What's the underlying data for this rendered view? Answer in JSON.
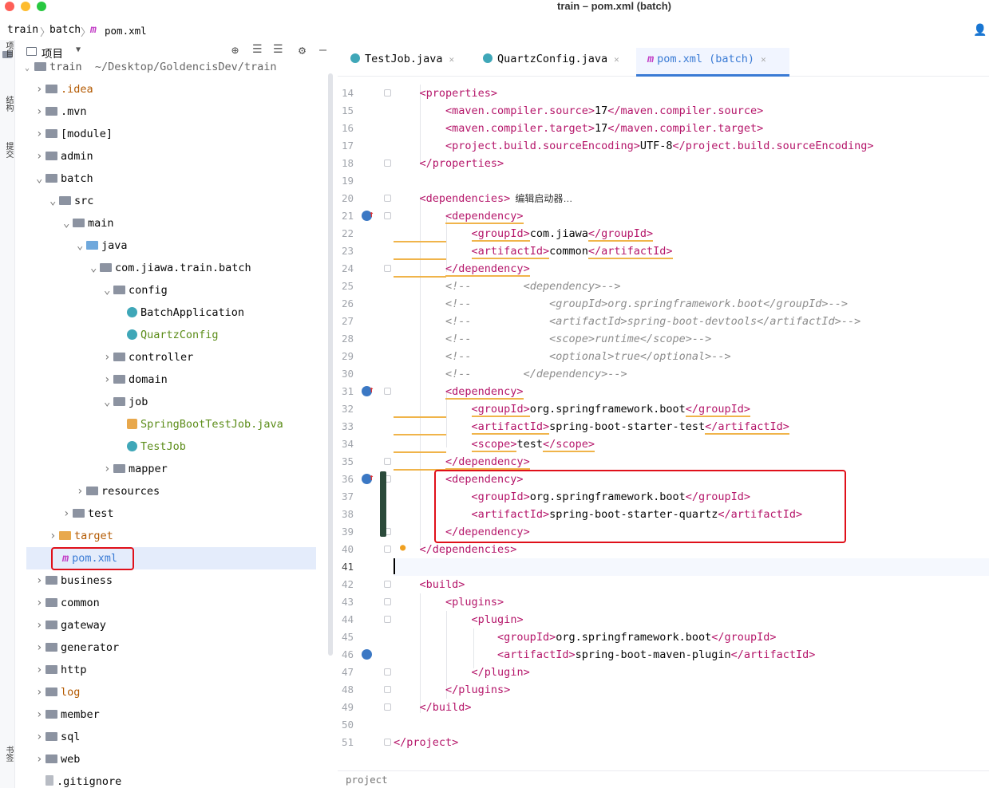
{
  "window": {
    "title": "train – pom.xml (batch)"
  },
  "breadcrumb": {
    "items": [
      "train",
      "batch",
      "pom.xml"
    ]
  },
  "left_strip": {
    "items": [
      "项目",
      "结构",
      "提交",
      "书签"
    ]
  },
  "project_panel": {
    "title": "项目",
    "root_label": "train",
    "root_path": "~/Desktop/GoldencisDev/train"
  },
  "tree": [
    {
      "label": ".idea",
      "depth": 1,
      "type": "folder",
      "color": "#b35900"
    },
    {
      "label": ".mvn",
      "depth": 1,
      "type": "folder"
    },
    {
      "label": "[module]",
      "depth": 1,
      "type": "folder"
    },
    {
      "label": "admin",
      "depth": 1,
      "type": "module"
    },
    {
      "label": "batch",
      "depth": 1,
      "type": "module",
      "open": true
    },
    {
      "label": "src",
      "depth": 2,
      "type": "folder",
      "open": true
    },
    {
      "label": "main",
      "depth": 3,
      "type": "folder",
      "open": true
    },
    {
      "label": "java",
      "depth": 4,
      "type": "folder-blue",
      "open": true
    },
    {
      "label": "com.jiawa.train.batch",
      "depth": 5,
      "type": "package",
      "open": true
    },
    {
      "label": "config",
      "depth": 6,
      "type": "package",
      "open": true
    },
    {
      "label": "BatchApplication",
      "depth": 7,
      "type": "class"
    },
    {
      "label": "QuartzConfig",
      "depth": 7,
      "type": "class",
      "color": "#5b8c18"
    },
    {
      "label": "controller",
      "depth": 6,
      "type": "package"
    },
    {
      "label": "domain",
      "depth": 6,
      "type": "package"
    },
    {
      "label": "job",
      "depth": 6,
      "type": "package",
      "open": true
    },
    {
      "label": "SpringBootTestJob.java",
      "depth": 7,
      "type": "java",
      "color": "#5b8c18"
    },
    {
      "label": "TestJob",
      "depth": 7,
      "type": "class",
      "color": "#5b8c18"
    },
    {
      "label": "mapper",
      "depth": 6,
      "type": "package"
    },
    {
      "label": "resources",
      "depth": 4,
      "type": "folder"
    },
    {
      "label": "test",
      "depth": 3,
      "type": "folder"
    },
    {
      "label": "target",
      "depth": 2,
      "type": "folder-orange",
      "color": "#b35900"
    },
    {
      "label": "pom.xml",
      "depth": 2,
      "type": "maven",
      "color": "#3a7bd5",
      "selected": true
    },
    {
      "label": "business",
      "depth": 1,
      "type": "module"
    },
    {
      "label": "common",
      "depth": 1,
      "type": "module"
    },
    {
      "label": "gateway",
      "depth": 1,
      "type": "module"
    },
    {
      "label": "generator",
      "depth": 1,
      "type": "module"
    },
    {
      "label": "http",
      "depth": 1,
      "type": "folder"
    },
    {
      "label": "log",
      "depth": 1,
      "type": "folder",
      "color": "#b35900"
    },
    {
      "label": "member",
      "depth": 1,
      "type": "module"
    },
    {
      "label": "sql",
      "depth": 1,
      "type": "folder"
    },
    {
      "label": "web",
      "depth": 1,
      "type": "folder"
    },
    {
      "label": ".gitignore",
      "depth": 1,
      "type": "file"
    }
  ],
  "tabs": [
    {
      "label": "TestJob.java",
      "active": false
    },
    {
      "label": "QuartzConfig.java",
      "active": false
    },
    {
      "label": "pom.xml (batch)",
      "active": true
    }
  ],
  "inlay_hint": "编辑启动器…",
  "code_lines": [
    {
      "n": "14",
      "html": "    <properties>"
    },
    {
      "n": "15",
      "html": "        <maven.compiler.source>17</maven.compiler.source>"
    },
    {
      "n": "16",
      "html": "        <maven.compiler.target>17</maven.compiler.target>"
    },
    {
      "n": "17",
      "html": "        <project.build.sourceEncoding>UTF-8</project.build.sourceEncoding>"
    },
    {
      "n": "18",
      "html": "    </properties>"
    },
    {
      "n": "19",
      "html": ""
    },
    {
      "n": "20",
      "html": "    <dependencies>"
    },
    {
      "n": "21",
      "html": "        <dependency>"
    },
    {
      "n": "22",
      "html": "            <groupId>com.jiawa</groupId>"
    },
    {
      "n": "23",
      "html": "            <artifactId>common</artifactId>"
    },
    {
      "n": "24",
      "html": "        </dependency>"
    },
    {
      "n": "25",
      "html": "        <!--        <dependency>-->"
    },
    {
      "n": "26",
      "html": "        <!--            <groupId>org.springframework.boot</groupId>-->"
    },
    {
      "n": "27",
      "html": "        <!--            <artifactId>spring-boot-devtools</artifactId>-->"
    },
    {
      "n": "28",
      "html": "        <!--            <scope>runtime</scope>-->"
    },
    {
      "n": "29",
      "html": "        <!--            <optional>true</optional>-->"
    },
    {
      "n": "30",
      "html": "        <!--        </dependency>-->"
    },
    {
      "n": "31",
      "html": "        <dependency>"
    },
    {
      "n": "32",
      "html": "            <groupId>org.springframework.boot</groupId>"
    },
    {
      "n": "33",
      "html": "            <artifactId>spring-boot-starter-test</artifactId>"
    },
    {
      "n": "34",
      "html": "            <scope>test</scope>"
    },
    {
      "n": "35",
      "html": "        </dependency>"
    },
    {
      "n": "36",
      "html": "        <dependency>"
    },
    {
      "n": "37",
      "html": "            <groupId>org.springframework.boot</groupId>"
    },
    {
      "n": "38",
      "html": "            <artifactId>spring-boot-starter-quartz</artifactId>"
    },
    {
      "n": "39",
      "html": "        </dependency>"
    },
    {
      "n": "40",
      "html": "    </dependencies>"
    },
    {
      "n": "41",
      "html": ""
    },
    {
      "n": "42",
      "html": "    <build>"
    },
    {
      "n": "43",
      "html": "        <plugins>"
    },
    {
      "n": "44",
      "html": "            <plugin>"
    },
    {
      "n": "45",
      "html": "                <groupId>org.springframework.boot</groupId>"
    },
    {
      "n": "46",
      "html": "                <artifactId>spring-boot-maven-plugin</artifactId>"
    },
    {
      "n": "47",
      "html": "            </plugin>"
    },
    {
      "n": "48",
      "html": "        </plugins>"
    },
    {
      "n": "49",
      "html": "    </build>"
    },
    {
      "n": "50",
      "html": ""
    },
    {
      "n": "51",
      "html": "</project>"
    }
  ],
  "status": {
    "path": "project"
  },
  "colors": {
    "accent": "#3a7bd5",
    "highlight_box": "#e0101a",
    "warning_underline": "#f0b44a",
    "tag": "#b5166a"
  }
}
